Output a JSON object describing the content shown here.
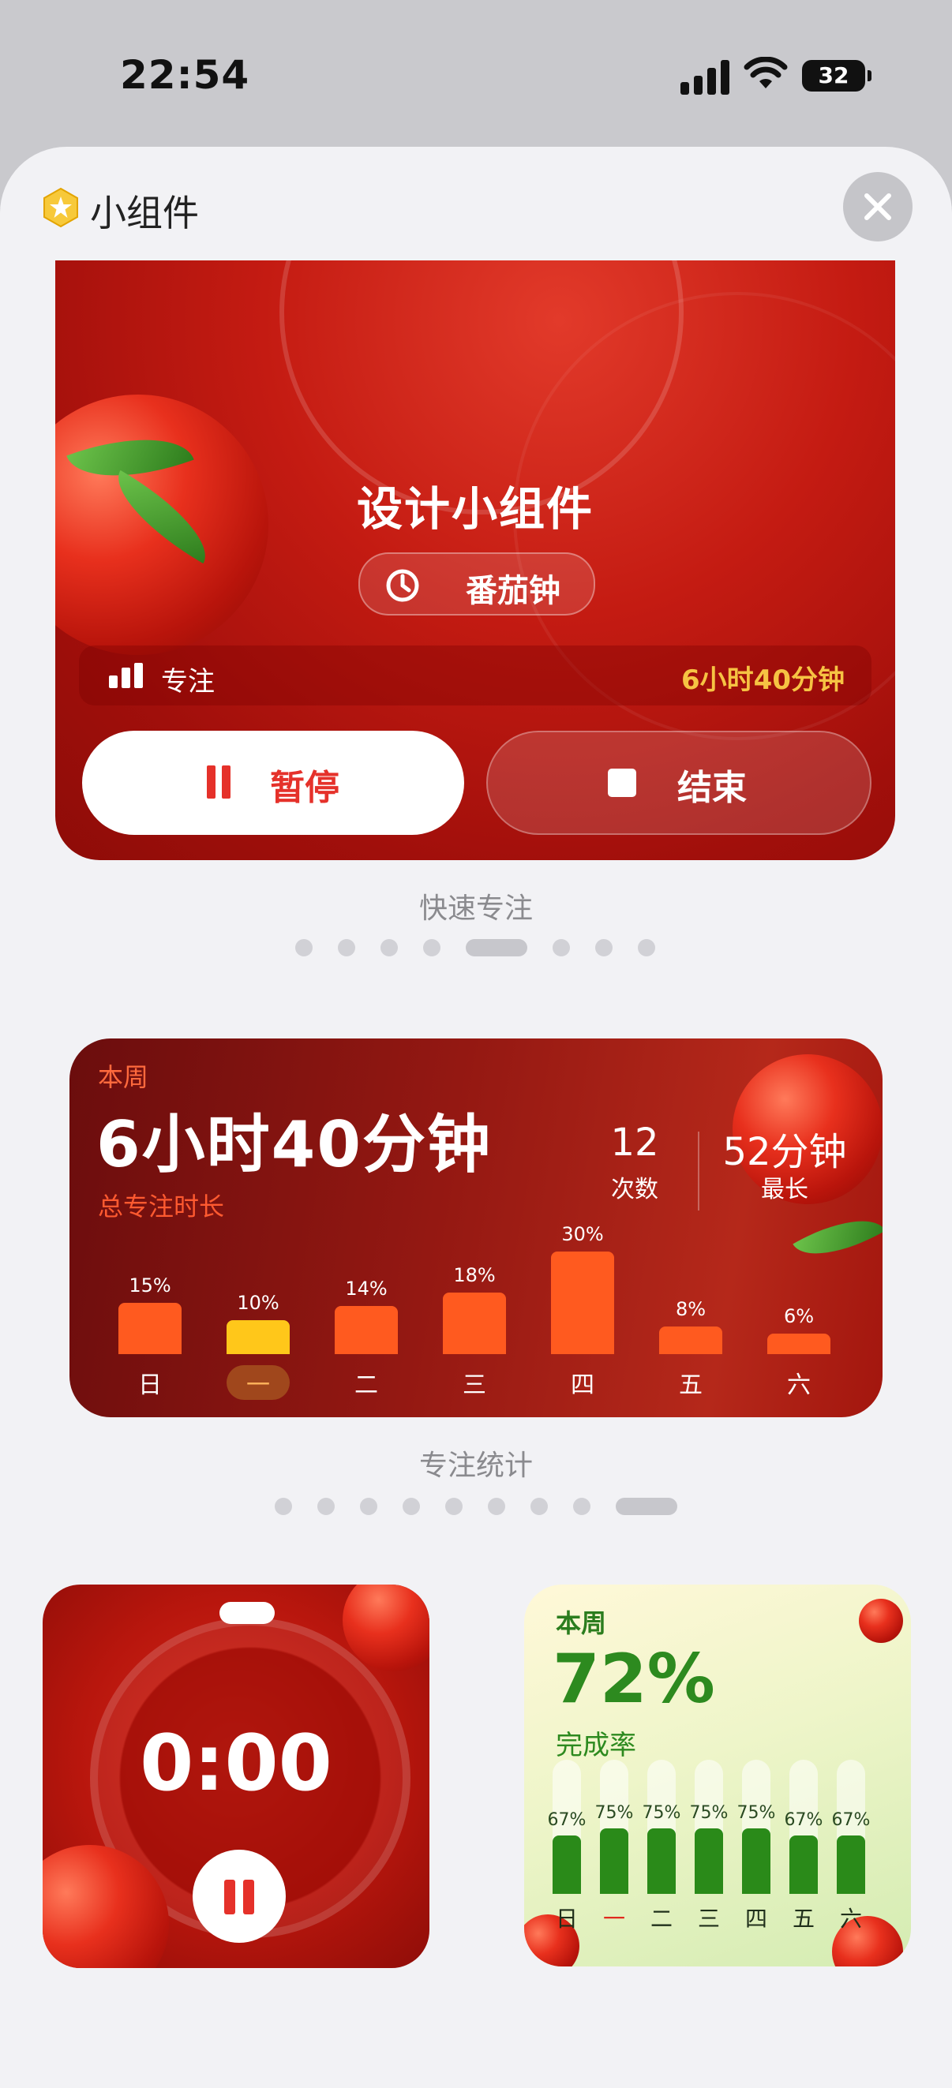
{
  "status_bar": {
    "time": "22:54",
    "battery": "32"
  },
  "sheet": {
    "title": "小组件"
  },
  "focus_widget": {
    "task_title": "设计小组件",
    "mode": "番茄钟",
    "focus_label": "专注",
    "focus_value": "6小时40分钟",
    "pause_label": "暂停",
    "end_label": "结束",
    "caption": "快速专注",
    "page_count": 8,
    "page_active": 4
  },
  "stats_widget": {
    "period": "本周",
    "total": "6小时40分钟",
    "total_label": "总专注时长",
    "count": "12",
    "count_label": "次数",
    "longest": "52分钟",
    "longest_label": "最长",
    "caption": "专注统计",
    "page_count": 9,
    "page_active": 8
  },
  "chart_data": [
    {
      "type": "bar",
      "categories": [
        "日",
        "一",
        "二",
        "三",
        "四",
        "五",
        "六"
      ],
      "values": [
        15,
        10,
        14,
        18,
        30,
        8,
        6
      ],
      "labels": [
        "15%",
        "10%",
        "14%",
        "18%",
        "30%",
        "8%",
        "6%"
      ],
      "highlight_index": 1,
      "colors": {
        "bar": "#ff5a1f",
        "highlight": "#ffc71a"
      }
    },
    {
      "type": "bar",
      "categories": [
        "日",
        "一",
        "二",
        "三",
        "四",
        "五",
        "六"
      ],
      "values": [
        67,
        null,
        75,
        75,
        75,
        75,
        67,
        67
      ],
      "series_values": [
        67,
        75,
        75,
        75,
        75,
        67,
        67
      ],
      "labels": [
        "67%",
        "75%",
        "75%",
        "75%",
        "75%",
        "67%",
        "67%"
      ],
      "highlight_index": 1,
      "colors": {
        "bar": "#2a8a19"
      }
    }
  ],
  "timer_widget": {
    "time": "0:00"
  },
  "rate_widget": {
    "period": "本周",
    "value": "72%",
    "label": "完成率"
  }
}
